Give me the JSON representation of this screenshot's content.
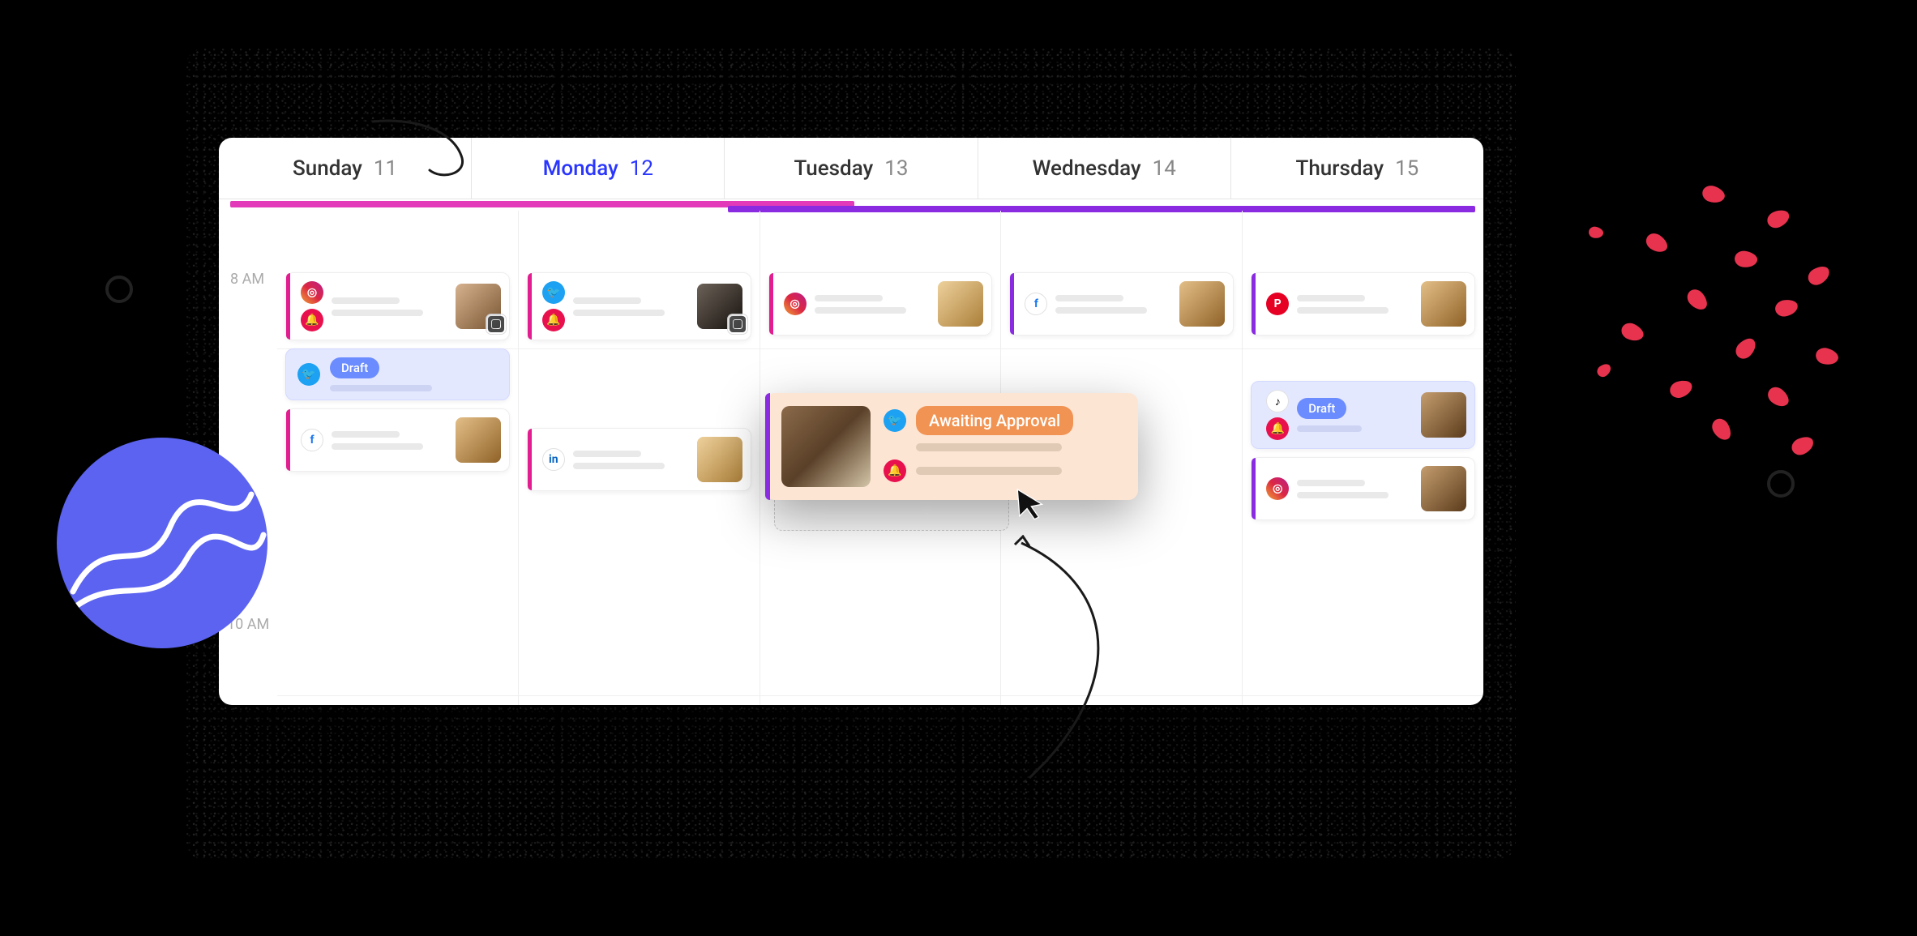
{
  "days": [
    {
      "name": "Sunday",
      "num": "11",
      "active": false
    },
    {
      "name": "Monday",
      "num": "12",
      "active": true
    },
    {
      "name": "Tuesday",
      "num": "13",
      "active": false
    },
    {
      "name": "Wednesday",
      "num": "14",
      "active": false
    },
    {
      "name": "Thursday",
      "num": "15",
      "active": false
    }
  ],
  "times": {
    "t8": "8 AM",
    "t10": "10 AM"
  },
  "badges": {
    "draft": "Draft",
    "await": "Awaiting Approval"
  },
  "icons": {
    "instagram": "instagram-icon",
    "twitter": "twitter-icon",
    "facebook": "facebook-icon",
    "linkedin": "linkedin-icon",
    "pinterest": "pinterest-icon",
    "tiktok": "tiktok-icon",
    "bell": "bell-icon"
  }
}
